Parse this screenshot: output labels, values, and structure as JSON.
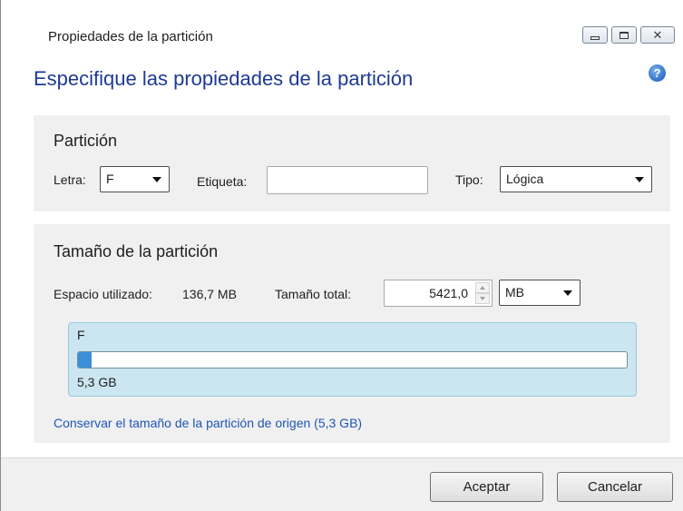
{
  "window": {
    "title": "Propiedades de la partición"
  },
  "header": {
    "title": "Especifique las propiedades de la partición",
    "help_icon": "help-icon"
  },
  "partition": {
    "title": "Partición",
    "letter_label": "Letra:",
    "letter_value": "F",
    "tag_label": "Etiqueta:",
    "tag_value": "",
    "type_label": "Tipo:",
    "type_value": "Lógica"
  },
  "size": {
    "title": "Tamaño de la partición",
    "used_label": "Espacio utilizado:",
    "used_value": "136,7 MB",
    "total_label": "Tamaño total:",
    "total_value": "5421,0",
    "unit_value": "MB",
    "part_letter": "F",
    "part_size": "5,3 GB",
    "used_fraction": 0.025,
    "keep_link": "Conservar el tamaño de la partición de origen (5,3 GB)"
  },
  "buttons": {
    "ok": "Aceptar",
    "cancel": "Cancelar"
  },
  "colors": {
    "accent_title": "#1e3a94",
    "link": "#1e55b8",
    "bar_fill": "#3b8fd9",
    "partition_box": "#cbe6f1"
  }
}
